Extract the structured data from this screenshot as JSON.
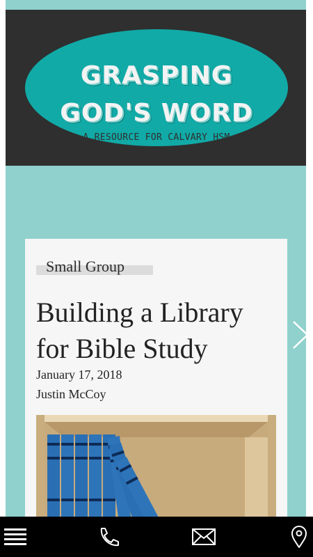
{
  "header": {
    "logo_line1": "GRASPING",
    "logo_line2": "GOD'S WORD",
    "logo_subtitle": "A RESOURCE FOR CALVARY HSM"
  },
  "post": {
    "category": "Small Group",
    "title": "Building a Library for Bible Study",
    "date": "January 17, 2018",
    "author": "Justin McCoy",
    "image": "bookshelf-with-blue-bible-commentaries"
  },
  "navigation": {
    "next_icon": "chevron-right-icon"
  },
  "bottom_bar": {
    "icons": [
      "menu-icon",
      "phone-icon",
      "mail-icon",
      "location-pin-icon"
    ]
  },
  "colors": {
    "page_teal": "#90d1cd",
    "header_dark": "#2f2f2f",
    "logo_teal": "#11aaa7",
    "card_bg": "#f6f6f6",
    "bottom_bar": "#000000"
  }
}
